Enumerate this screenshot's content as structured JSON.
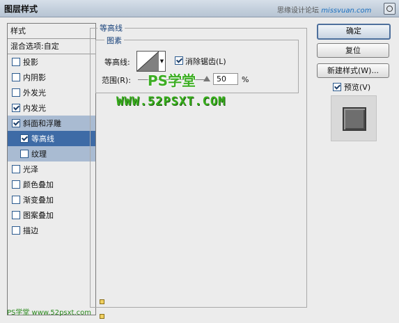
{
  "window": {
    "title": "图层样式"
  },
  "watermark": {
    "text": "思缘设计论坛",
    "logo": "missvuan.com"
  },
  "left_list": {
    "header": "样式",
    "blend": "混合选项:自定",
    "items": [
      {
        "label": "投影",
        "checked": false
      },
      {
        "label": "内阴影",
        "checked": false
      },
      {
        "label": "外发光",
        "checked": false
      },
      {
        "label": "内发光",
        "checked": true
      },
      {
        "label": "斜面和浮雕",
        "checked": true
      },
      {
        "label": "等高线",
        "checked": true
      },
      {
        "label": "纹理",
        "checked": false
      },
      {
        "label": "光泽",
        "checked": false
      },
      {
        "label": "颜色叠加",
        "checked": false
      },
      {
        "label": "渐变叠加",
        "checked": false
      },
      {
        "label": "图案叠加",
        "checked": false
      },
      {
        "label": "描边",
        "checked": false
      }
    ]
  },
  "panel": {
    "section_title": "等高线",
    "group_title": "图素",
    "contour_label": "等高线:",
    "antialias_label": "消除锯齿(L)",
    "antialias_checked": true,
    "range_label": "范围(R):",
    "range_value": "50",
    "range_unit": "%"
  },
  "buttons": {
    "ok": "确定",
    "reset": "复位",
    "new_style": "新建样式(W)...",
    "preview_label": "预览(V)",
    "preview_checked": true
  },
  "overlay": {
    "ps_logo": "PS学堂",
    "site": "WWW.52PSXT.COM",
    "bottom": "PS学堂 www.52psxt.com"
  },
  "colors": {
    "accent": "#3e6ba6",
    "selected_light": "#a9bbd2",
    "logo_green": "#3dae24"
  }
}
